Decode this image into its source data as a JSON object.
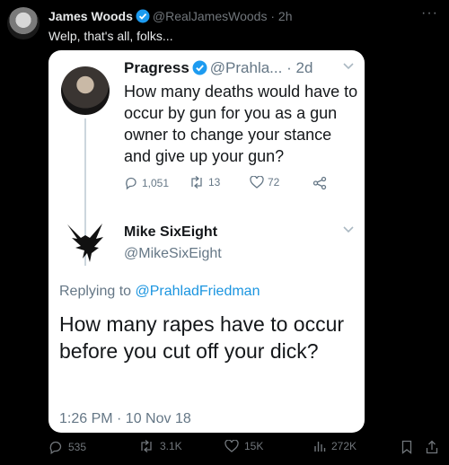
{
  "tweet": {
    "author_name": "James Woods",
    "author_handle": "@RealJamesWoods",
    "separator": "·",
    "time": "2h",
    "text": "Welp, that's all, folks..."
  },
  "quoted": {
    "original": {
      "author_name": "Pragress",
      "author_handle": "@Prahla...",
      "separator": "·",
      "time": "2d",
      "text": "How many deaths would have to occur by gun for you as a gun owner to change your stance and give up your gun?",
      "replies": "1,051",
      "retweets": "13",
      "likes": "72"
    },
    "reply": {
      "author_name": "Mike SixEight",
      "author_handle": "@MikeSixEight",
      "replying_to_label": "Replying to",
      "replying_to_handle": "@PrahladFriedman",
      "text": "How many rapes have to occur before you cut off your dick?",
      "timestamp": "1:26 PM · 10 Nov 18"
    }
  },
  "actions": {
    "replies": "535",
    "reposts": "3.1K",
    "likes": "15K",
    "views": "272K"
  },
  "colors": {
    "background": "#000000",
    "verified": "#1d9bf0",
    "link": "#1b95e0"
  }
}
